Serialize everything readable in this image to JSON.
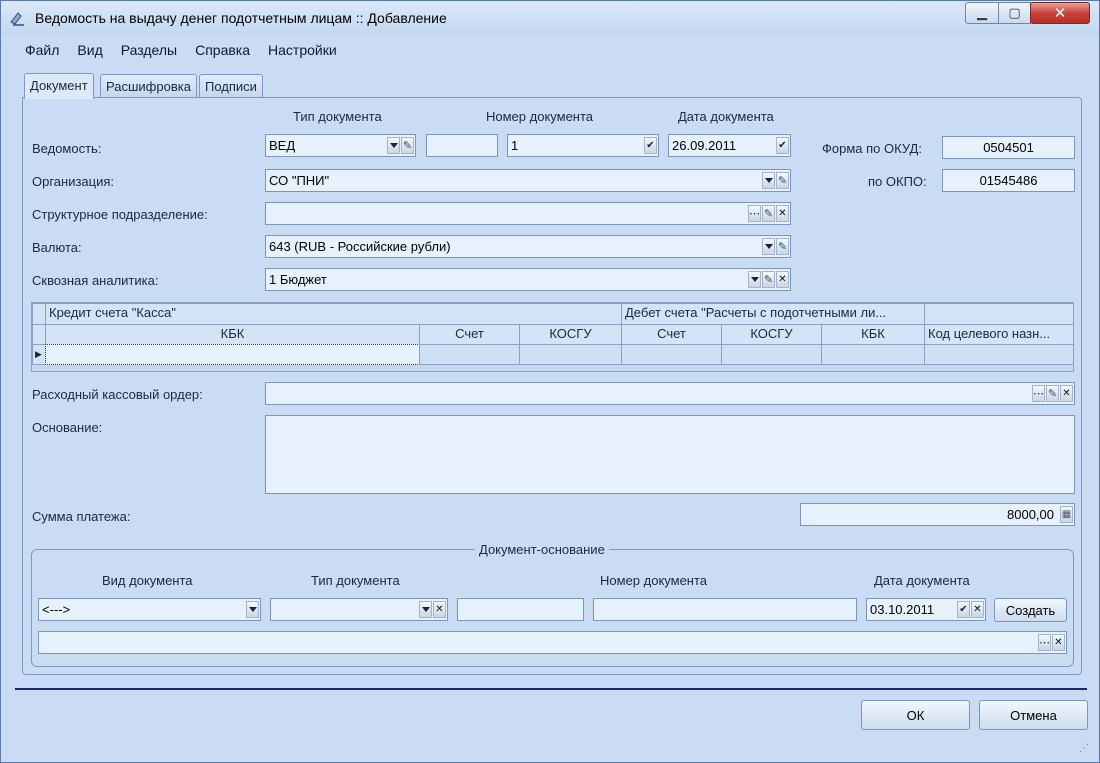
{
  "window": {
    "title": "Ведомость на выдачу денег подотчетным лицам :: Добавление",
    "min_label": "▁",
    "max_label": "▢",
    "close_label": "✕"
  },
  "menu": [
    "Файл",
    "Вид",
    "Разделы",
    "Справка",
    "Настройки"
  ],
  "tabs": [
    "Документ",
    "Расшифровка",
    "Подписи"
  ],
  "headers": {
    "doc_type": "Тип документа",
    "doc_number": "Номер документа",
    "doc_date": "Дата документа"
  },
  "labels": {
    "statement": "Ведомость:",
    "organization": "Организация:",
    "subdivision": "Структурное подразделение:",
    "currency": "Валюта:",
    "analytics": "Сквозная аналитика:",
    "okud": "Форма по ОКУД:",
    "okpo": "по ОКПО:",
    "cash_order": "Расходный кассовый ордер:",
    "basis": "Основание:",
    "payment_sum": "Сумма платежа:"
  },
  "values": {
    "doc_type": "ВЕД",
    "doc_extra": "",
    "doc_number": "1",
    "doc_date": "26.09.2011",
    "okud": "0504501",
    "okpo": "01545486",
    "organization": "СО \"ПНИ\"",
    "subdivision": "",
    "currency": "643 (RUB - Российские рубли)",
    "analytics": "1 Бюджет",
    "cash_order": "",
    "basis": "",
    "payment_sum": "8000,00"
  },
  "grid": {
    "group_credit": "Кредит счета \"Касса\"",
    "group_debit": "Дебет счета \"Расчеты с подотчетными ли...",
    "columns": [
      "КБК",
      "Счет",
      "КОСГУ",
      "Счет",
      "КОСГУ",
      "КБК",
      "Код целевого назн..."
    ],
    "row_marker": "▶"
  },
  "basis_doc": {
    "title": "Документ-основание",
    "headers": {
      "kind": "Вид документа",
      "type": "Тип документа",
      "number": "Номер документа",
      "date": "Дата документа"
    },
    "kind_value": "<--->",
    "type_value": "",
    "extra_value": "",
    "number_value": "",
    "date_value": "03.10.2011",
    "create_label": "Создать",
    "link_value": ""
  },
  "footer": {
    "ok_label": "ОК",
    "cancel_label": "Отмена"
  }
}
